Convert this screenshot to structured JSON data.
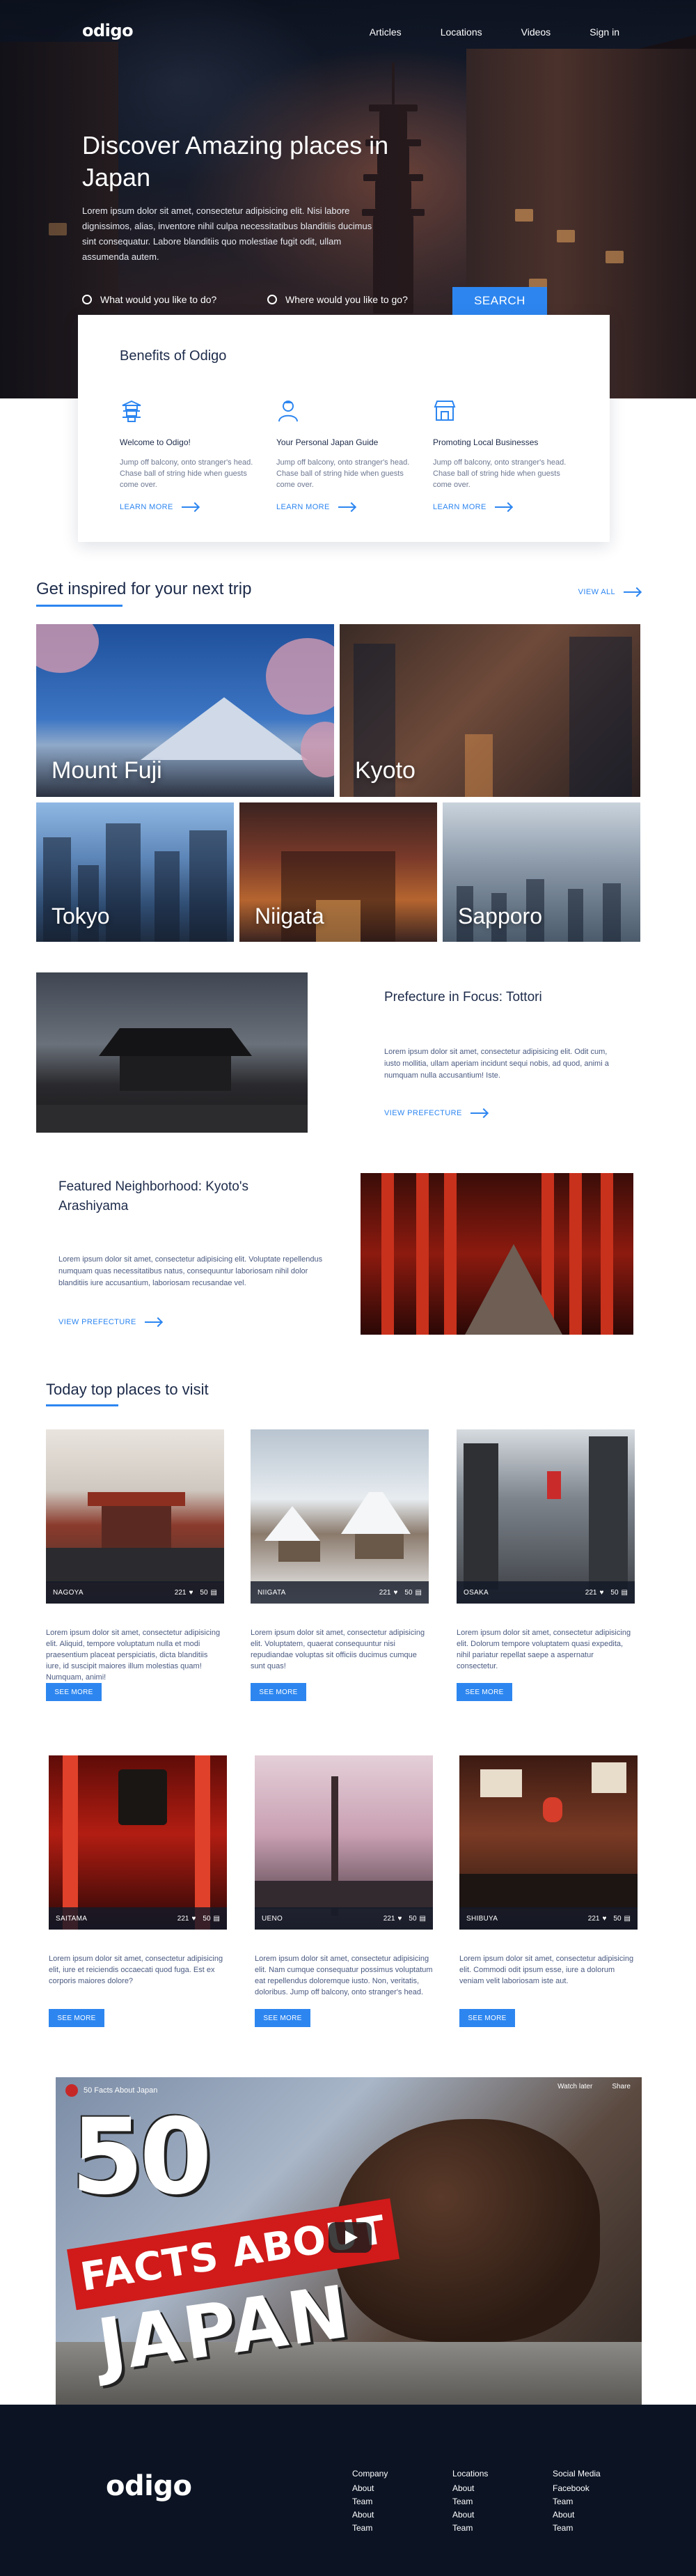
{
  "nav": {
    "logo": "odigo",
    "links": [
      "Articles",
      "Locations",
      "Videos",
      "Sign in"
    ]
  },
  "hero": {
    "title": "Discover Amazing places in Japan",
    "text": "Lorem ipsum dolor sit amet, consectetur adipisicing elit. Nisi labore dignissimos, alias, inventore nihil culpa necessitatibus blanditiis ducimus sint consequatur. Labore blanditiis quo molestiae fugit odit, ullam assumenda autem.",
    "search_what_placeholder": "What would you like to do?",
    "search_where_placeholder": "Where would you like to go?",
    "search_button": "SEARCH"
  },
  "benefits": {
    "title": "Benefits of Odigo",
    "items": [
      {
        "icon": "pagoda-icon",
        "title": "Welcome to Odigo!",
        "text": "Jump off balcony, onto stranger's head. Chase ball of string hide when guests come over.",
        "link": "LEARN MORE"
      },
      {
        "icon": "guide-person-icon",
        "title": "Your Personal Japan Guide",
        "text": "Jump off balcony, onto stranger's head. Chase ball of string hide when guests come over.",
        "link": "LEARN MORE"
      },
      {
        "icon": "shop-icon",
        "title": "Promoting Local Businesses",
        "text": "Jump off balcony, onto stranger's head. Chase ball of string hide when guests come over.",
        "link": "LEARN MORE"
      }
    ]
  },
  "inspired": {
    "title": "Get inspired for your next trip",
    "view_all": "VIEW ALL",
    "tiles": [
      "Mount Fuji",
      "Kyoto",
      "Tokyo",
      "Niigata",
      "Sapporo"
    ]
  },
  "features": [
    {
      "title": "Prefecture in Focus: Tottori",
      "text": "Lorem ipsum dolor sit amet, consectetur adipisicing elit. Odit cum, iusto mollitia, ullam aperiam incidunt sequi nobis, ad quod, animi a numquam nulla accusantium! Iste.",
      "link": "VIEW PREFECTURE"
    },
    {
      "title": "Featured Neighborhood: Kyoto's Arashiyama",
      "text": "Lorem ipsum dolor sit amet, consectetur adipisicing elit. Voluptate repellendus numquam quas necessitatibus natus, consequuntur laboriosam nihil dolor blanditiis iure accusantium, laboriosam recusandae vel.",
      "link": "VIEW PREFECTURE"
    }
  ],
  "top_places": {
    "title": "Today top places to visit",
    "items": [
      {
        "name": "NAGOYA",
        "likes": "221",
        "comments": "50",
        "text": "Lorem ipsum dolor sit amet, consectetur adipisicing elit. Aliquid, tempore voluptatum nulla et modi praesentium placeat perspiciatis, dicta blanditiis iure, id suscipit maiores illum molestias quam! Numquam, animi!",
        "button": "SEE MORE"
      },
      {
        "name": "NIIGATA",
        "likes": "221",
        "comments": "50",
        "text": "Lorem ipsum dolor sit amet, consectetur adipisicing elit. Voluptatem, quaerat consequuntur nisi repudiandae voluptas sit officiis ducimus cumque sunt quas!",
        "button": "SEE MORE"
      },
      {
        "name": "OSAKA",
        "likes": "221",
        "comments": "50",
        "text": "Lorem ipsum dolor sit amet, consectetur adipisicing elit. Dolorum tempore voluptatem quasi expedita, nihil pariatur repellat saepe a aspernatur consectetur.",
        "button": "SEE MORE"
      },
      {
        "name": "SAITAMA",
        "likes": "221",
        "comments": "50",
        "text": "Lorem ipsum dolor sit amet, consectetur adipisicing elit, iure et reiciendis occaecati quod fuga. Est ex corporis maiores dolore?",
        "button": "SEE MORE"
      },
      {
        "name": "UENO",
        "likes": "221",
        "comments": "50",
        "text": "Lorem ipsum dolor sit amet, consectetur adipisicing elit. Nam cumque consequatur possimus voluptatum eat repellendus doloremque iusto. Non, veritatis, doloribus. Jump off balcony, onto stranger's head.",
        "button": "SEE MORE"
      },
      {
        "name": "SHIBUYA",
        "likes": "221",
        "comments": "50",
        "text": "Lorem ipsum dolor sit amet, consectetur adipisicing elit. Commodi odit ipsum esse, iure a dolorum veniam velit laboriosam iste aut.",
        "button": "SEE MORE"
      }
    ]
  },
  "video": {
    "channel_title": "50 Facts About Japan",
    "overlay_number": "50",
    "overlay_facts": "FACTS ABOUT",
    "overlay_country": "JAPAN",
    "watch_later": "Watch later",
    "share": "Share"
  },
  "footer": {
    "logo": "odigo",
    "columns": [
      {
        "heading": "Company",
        "items": [
          "About",
          "Team",
          "About",
          "Team"
        ]
      },
      {
        "heading": "Locations",
        "items": [
          "About",
          "Team",
          "About",
          "Team"
        ]
      },
      {
        "heading": "Social Media",
        "items": [
          "Facebook",
          "Team",
          "About",
          "Team"
        ]
      }
    ]
  },
  "colors": {
    "accent": "#2d86f0",
    "heading": "#1d2b4a",
    "footer_bg": "#0c1424"
  }
}
